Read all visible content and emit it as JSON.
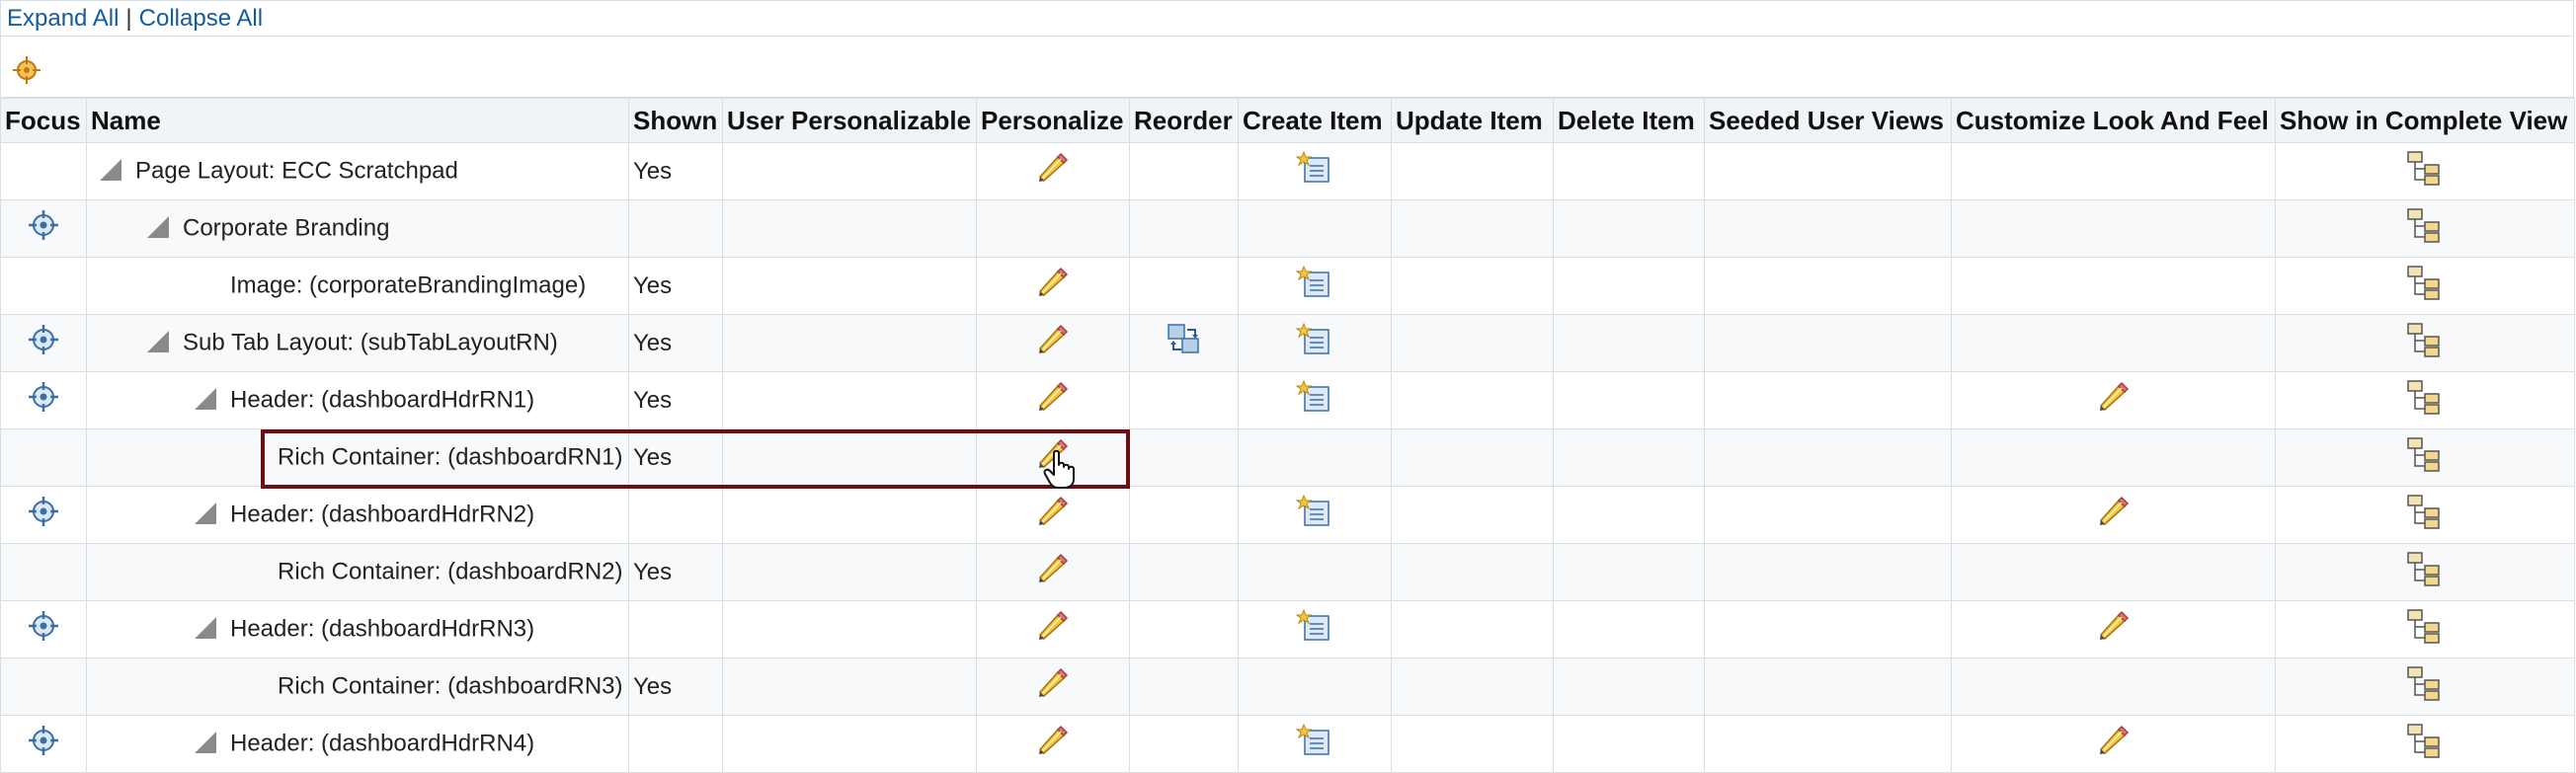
{
  "toolbar": {
    "expand_all": "Expand All",
    "separator": "|",
    "collapse_all": "Collapse All"
  },
  "columns": [
    "Focus",
    "Name",
    "Shown",
    "User Personalizable",
    "Personalize",
    "Reorder",
    "Create Item",
    "Update Item",
    "Delete Item",
    "Seeded User Views",
    "Customize Look And Feel",
    "Show in Complete View"
  ],
  "rows": [
    {
      "name": "Page Layout: ECC Scratchpad",
      "level": 0,
      "expandable": true,
      "focus": false,
      "shown": "Yes",
      "personalize": true,
      "reorder": false,
      "create": true,
      "customize": false
    },
    {
      "name": "Corporate Branding",
      "level": 1,
      "expandable": true,
      "focus": true,
      "shown": "",
      "personalize": false,
      "reorder": false,
      "create": false,
      "customize": false
    },
    {
      "name": "Image: (corporateBrandingImage)",
      "level": 2,
      "expandable": false,
      "focus": false,
      "shown": "Yes",
      "personalize": true,
      "reorder": false,
      "create": true,
      "customize": false
    },
    {
      "name": "Sub Tab Layout: (subTabLayoutRN)",
      "level": 1,
      "expandable": true,
      "focus": true,
      "shown": "Yes",
      "personalize": true,
      "reorder": true,
      "create": true,
      "customize": false
    },
    {
      "name": "Header: (dashboardHdrRN1)",
      "level": 2,
      "expandable": true,
      "focus": true,
      "shown": "Yes",
      "personalize": true,
      "reorder": false,
      "create": true,
      "customize": true
    },
    {
      "name": "Rich Container: (dashboardRN1)",
      "level": 3,
      "expandable": false,
      "focus": false,
      "shown": "Yes",
      "personalize": true,
      "reorder": false,
      "create": false,
      "customize": false
    },
    {
      "name": "Header: (dashboardHdrRN2)",
      "level": 2,
      "expandable": true,
      "focus": true,
      "shown": "",
      "personalize": true,
      "reorder": false,
      "create": true,
      "customize": true
    },
    {
      "name": "Rich Container: (dashboardRN2)",
      "level": 3,
      "expandable": false,
      "focus": false,
      "shown": "Yes",
      "personalize": true,
      "reorder": false,
      "create": false,
      "customize": false
    },
    {
      "name": "Header: (dashboardHdrRN3)",
      "level": 2,
      "expandable": true,
      "focus": true,
      "shown": "",
      "personalize": true,
      "reorder": false,
      "create": true,
      "customize": true
    },
    {
      "name": "Rich Container: (dashboardRN3)",
      "level": 3,
      "expandable": false,
      "focus": false,
      "shown": "Yes",
      "personalize": true,
      "reorder": false,
      "create": false,
      "customize": false
    },
    {
      "name": "Header: (dashboardHdrRN4)",
      "level": 2,
      "expandable": true,
      "focus": true,
      "shown": "",
      "personalize": true,
      "reorder": false,
      "create": true,
      "customize": true
    }
  ],
  "icons": {
    "focus": "crosshair-icon",
    "personalize": "pencil-icon",
    "reorder": "reorder-icon",
    "create": "create-item-icon",
    "complete_view": "hierarchy-icon",
    "cursor": "hand-cursor-icon"
  },
  "colors": {
    "link": "#145c9e",
    "highlight": "#6b0f14",
    "focus_icon": "#3a6ea5"
  }
}
